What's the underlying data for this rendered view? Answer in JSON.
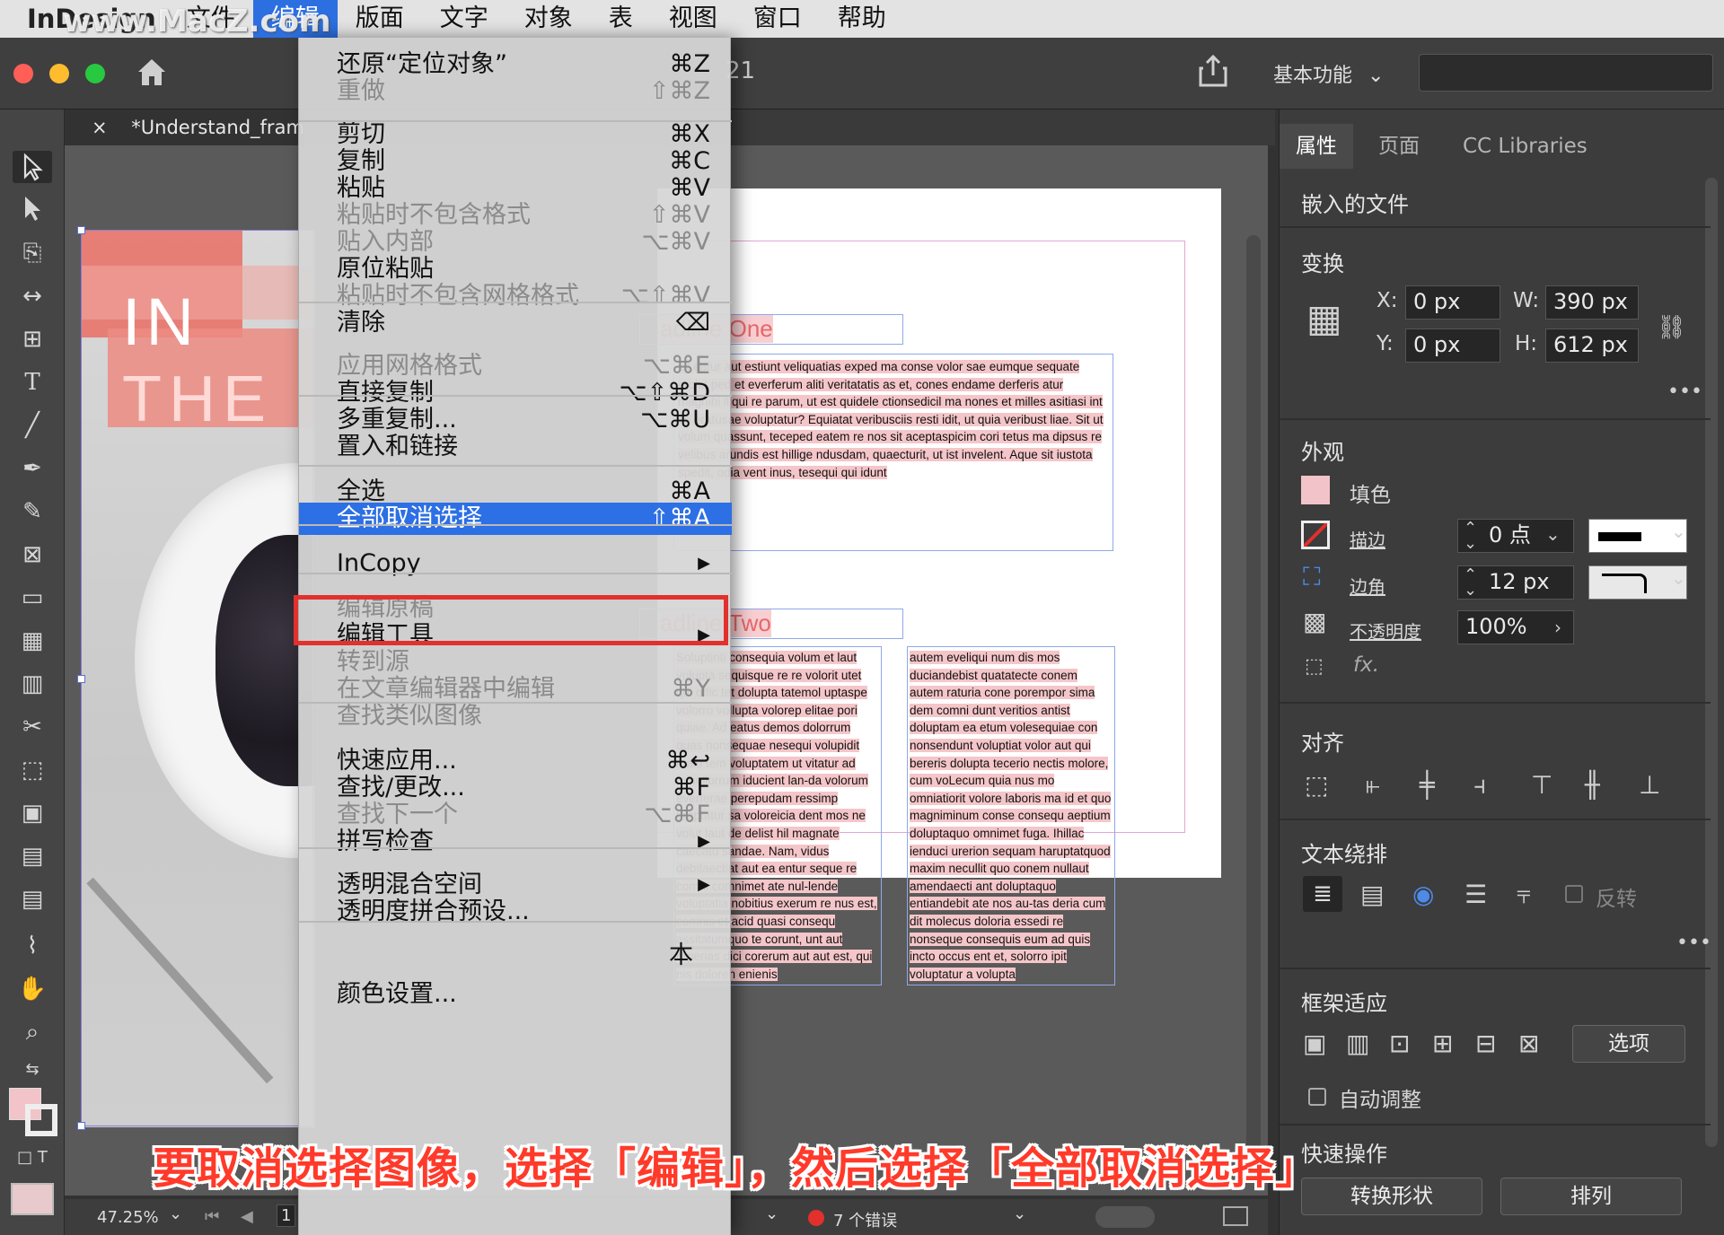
{
  "menubar": {
    "app": "InDesign",
    "items": [
      "文件",
      "编辑",
      "版面",
      "文字",
      "对象",
      "表",
      "视图",
      "窗口",
      "帮助"
    ],
    "active": "编辑"
  },
  "watermark": "www.MacZ.com",
  "header": {
    "workspace": "基本功能",
    "doc_fragment": "21"
  },
  "doc_tab": {
    "close": "×",
    "title": "*Understand_frame"
  },
  "edit_menu": {
    "items": [
      {
        "label": "还原“定位对象”",
        "shortcut": "⌘Z",
        "enabled": true
      },
      {
        "label": "重做",
        "shortcut": "⇧⌘Z",
        "enabled": false
      },
      {
        "label": "剪切",
        "shortcut": "⌘X",
        "enabled": true
      },
      {
        "label": "复制",
        "shortcut": "⌘C",
        "enabled": true
      },
      {
        "label": "粘贴",
        "shortcut": "⌘V",
        "enabled": true
      },
      {
        "label": "粘贴时不包含格式",
        "shortcut": "⇧⌘V",
        "enabled": false
      },
      {
        "label": "贴入内部",
        "shortcut": "⌥⌘V",
        "enabled": false
      },
      {
        "label": "原位粘贴",
        "shortcut": "",
        "enabled": true
      },
      {
        "label": "粘贴时不包含网格格式",
        "shortcut": "⌥⇧⌘V",
        "enabled": false
      },
      {
        "label": "清除",
        "shortcut": "⌫",
        "enabled": true
      },
      {
        "label": "应用网格格式",
        "shortcut": "⌥⌘E",
        "enabled": false
      },
      {
        "label": "直接复制",
        "shortcut": "⌥⇧⌘D",
        "enabled": true
      },
      {
        "label": "多重复制...",
        "shortcut": "⌥⌘U",
        "enabled": true
      },
      {
        "label": "置入和链接",
        "shortcut": "",
        "enabled": true
      },
      {
        "label": "全选",
        "shortcut": "⌘A",
        "enabled": true
      },
      {
        "label": "全部取消选择",
        "shortcut": "⇧⌘A",
        "enabled": true,
        "highlighted": true
      },
      {
        "label": "InCopy",
        "shortcut": "▶",
        "enabled": true
      },
      {
        "label": "编辑原稿",
        "shortcut": "",
        "enabled": false
      },
      {
        "label": "编辑工具",
        "shortcut": "▶",
        "enabled": true
      },
      {
        "label": "转到源",
        "shortcut": "",
        "enabled": false
      },
      {
        "label": "在文章编辑器中编辑",
        "shortcut": "⌘Y",
        "enabled": false
      },
      {
        "label": "查找类似图像",
        "shortcut": "",
        "enabled": false
      },
      {
        "label": "快速应用...",
        "shortcut": "⌘↩",
        "enabled": true
      },
      {
        "label": "查找/更改...",
        "shortcut": "⌘F",
        "enabled": true
      },
      {
        "label": "查找下一个",
        "shortcut": "⌥⌘F",
        "enabled": false
      },
      {
        "label": "拼写检查",
        "shortcut": "▶",
        "enabled": true
      },
      {
        "label": "透明混合空间",
        "shortcut": "▶",
        "enabled": true
      },
      {
        "label": "透明度拼合预设...",
        "shortcut": "",
        "enabled": true
      },
      {
        "label": "颜色设置...",
        "shortcut": "",
        "enabled": true
      }
    ],
    "overlap_char": "本"
  },
  "document": {
    "hero_line1": "IN",
    "hero_line2": "THE",
    "headline1": "adline One",
    "headline2": "adline Two",
    "body1": "Ut eatur aut estiunt veliquatias exped ma conse volor sae eumque sequate erchit ped et everferum aliti veritatatis as et, cones endame derferis atur magnihi lliqui re parum, ut est quidele ctionsedicil ma nones et milles asitiasi int as eratusae voluptatur? Equiatat veribusciis resti idit, ut quia veribust liae. Sit ut volum quassunt, teceped eatem re nos sit aceptaspicim cori tetus ma dipsus re velibus arundis est hillige ndusdam, quaecturit, ut ist invelent. Aque sit iustota spedit, odia vent inus, tesequi qui idunt",
    "col_left": "Soluptinti consequia volum et laut volupta sequisque re re volorit utet qui offic tet dolupta tatemol uptaspe volorro vollupta volorep elitae pori quiae. Ad eatus demos dolorrum quas nonsequae nesequi volupidit maio tem voluptatem ut vitatur ad minullorrum iducient lan-da volorum everferae perepudam ressimp oreptatur sa voloreicia dent mos ne volut laut de delist hil magnate caecatu sandae. Nam, vidus debitaectiat aut ea entur seque re comni comnimet ate nul-lende voluptatia nobitius exerum re nus est, comnis et acid quasi consequ assitatumquo te corunt, unt aut reperias dici corerum aut aut est, qui nis doloreh enienis",
    "col_right": "autem eveliqui num dis mos duciandebist quatatecte conem autem raturia cone porempor sima dem comni dunt veritios antist doluptam ea etum volesequiae con nonsendunt voluptiat volor aut qui bereris dolupta tecerio nectis molore, cum voLecum quia nus mo omniatiorit volore laboris ma id et quo magniminum conse consequ aeptium doluptaquo omnimet fuga. Ihillac ienduci urerion sequam haruptatquod maxim necullit quo conem nullaut amendaecti ant doluptaquo entiandebit ate nos au-tas deria cum dit molecus doloria essedi re nonseque consequis eum ad quis incto occus ent et, solorro ipit voluptatur a volupta"
  },
  "status": {
    "zoom": "47.25%",
    "page": "1",
    "errors": "7 个错误"
  },
  "panel": {
    "tabs": [
      "属性",
      "页面",
      "CC Libraries"
    ],
    "embedded": "嵌入的文件",
    "transform": {
      "title": "变换",
      "x_label": "X:",
      "x": "0 px",
      "y_label": "Y:",
      "y": "0 px",
      "w_label": "W:",
      "w": "390 px",
      "h_label": "H:",
      "h": "612 px"
    },
    "appearance": {
      "title": "外观",
      "fill": "填色",
      "stroke": "描边",
      "stroke_value": "0 点",
      "corner": "边角",
      "corner_value": "12 px",
      "opacity": "不透明度",
      "opacity_value": "100%",
      "fx": "fx."
    },
    "align": {
      "title": "对齐"
    },
    "wrap": {
      "title": "文本绕排",
      "invert": "反转"
    },
    "fit": {
      "title": "框架适应",
      "options": "选项",
      "auto": "自动调整"
    },
    "quick": {
      "title": "快速操作",
      "convert": "转换形状",
      "arrange": "排列"
    },
    "colors": {
      "fill_swatch": "#f2c3c8",
      "accent": "#2d6fe4",
      "highlight_border": "#e2302c"
    }
  },
  "caption": "要取消选择图像，选择「编辑」，然后选择「全部取消选择」"
}
